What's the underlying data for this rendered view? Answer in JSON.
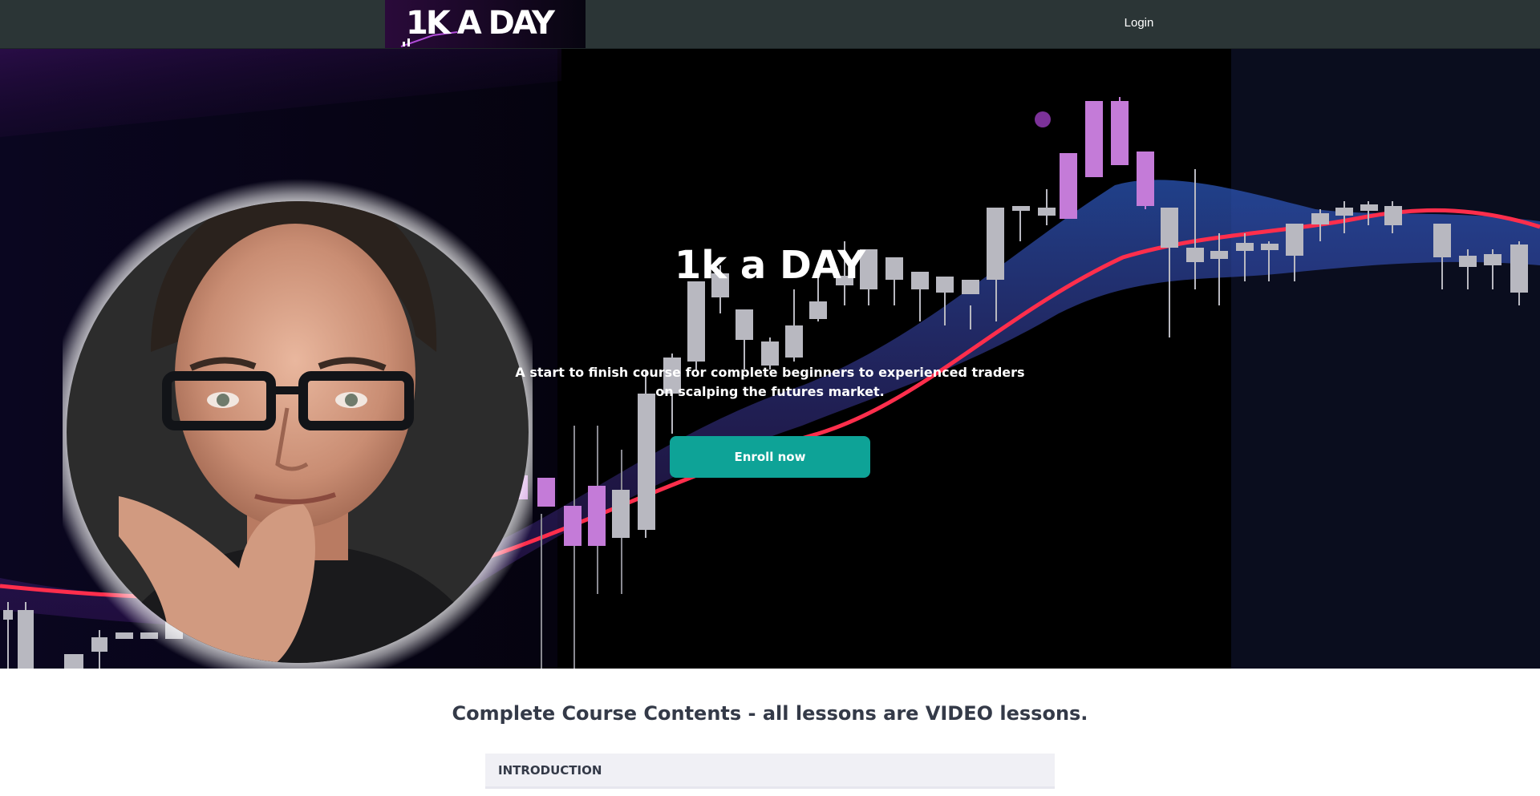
{
  "header": {
    "logo_text": "1K A DAY",
    "login_label": "Login"
  },
  "hero": {
    "title": "1k a DAY",
    "subtitle": "A start to finish course for complete beginners to experienced traders on scalping the futures market.",
    "cta_label": "Enroll now"
  },
  "contents": {
    "heading": "Complete Course Contents - all lessons are VIDEO lessons.",
    "sections": [
      {
        "title": "INTRODUCTION"
      }
    ]
  },
  "colors": {
    "topbar": "#2b3536",
    "cta": "#0ea397",
    "heading_text": "#343a48",
    "section_bg": "#f0f0f5",
    "candle_bull": "#c47bd8",
    "candle_neutral": "#b8b8c0",
    "ma_line": "#ff2e4c",
    "band": "#1f3f8f"
  }
}
